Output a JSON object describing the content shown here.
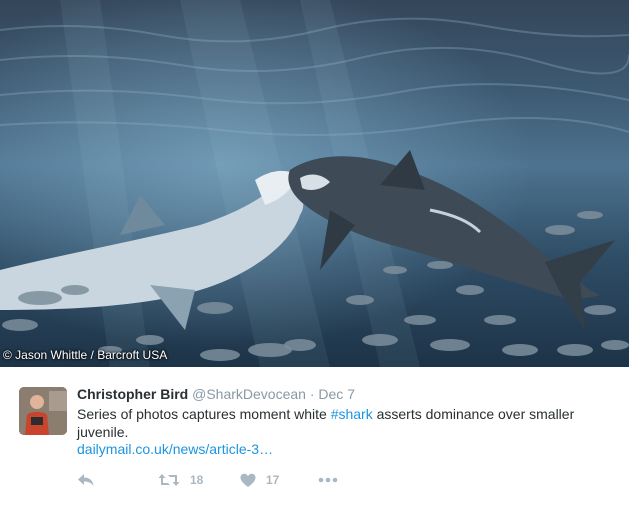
{
  "photo": {
    "credit": "© Jason Whittle / Barcroft USA",
    "subject": "shark-photo"
  },
  "tweet": {
    "author_name": "Christopher Bird",
    "author_handle": "@SharkDevocean",
    "separator": "·",
    "date": "Dec 7",
    "text_before": "Series of photos captures moment white ",
    "hashtag": "#shark",
    "text_after": " asserts dominance over smaller juvenile.",
    "link": "dailymail.co.uk/news/article-3…",
    "retweet_count": "18",
    "like_count": "17"
  },
  "icons": {
    "reply": "reply-icon",
    "retweet": "retweet-icon",
    "like": "heart-icon",
    "more": "more-icon"
  },
  "colors": {
    "link": "#1b95e0",
    "name": "#292f33",
    "muted": "#8899a6",
    "action": "#aab8c2"
  }
}
